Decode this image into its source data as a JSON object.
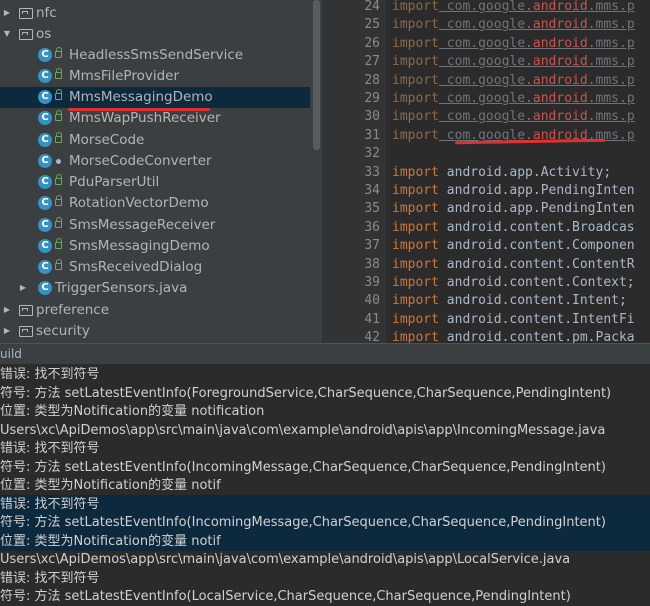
{
  "tree": {
    "items": [
      {
        "label": "nfc",
        "type": "folder",
        "expanded": false
      },
      {
        "label": "os",
        "type": "folder",
        "expanded": true
      },
      {
        "label": "HeadlessSmsSendService",
        "type": "class"
      },
      {
        "label": "MmsFileProvider",
        "type": "class"
      },
      {
        "label": "MmsMessagingDemo",
        "type": "class",
        "selected": true
      },
      {
        "label": "MmsWapPushReceiver",
        "type": "class"
      },
      {
        "label": "MorseCode",
        "type": "class"
      },
      {
        "label": "MorseCodeConverter",
        "type": "class"
      },
      {
        "label": "PduParserUtil",
        "type": "class"
      },
      {
        "label": "RotationVectorDemo",
        "type": "class"
      },
      {
        "label": "SmsMessageReceiver",
        "type": "class"
      },
      {
        "label": "SmsMessagingDemo",
        "type": "class"
      },
      {
        "label": "SmsReceivedDialog",
        "type": "class"
      },
      {
        "label": "TriggerSensors.java",
        "type": "class-file"
      },
      {
        "label": "preference",
        "type": "folder",
        "expanded": false
      },
      {
        "label": "security",
        "type": "folder",
        "expanded": false
      }
    ]
  },
  "editor": {
    "lines": [
      {
        "num": "24",
        "text": "import com.google.android.mms.p"
      },
      {
        "num": "25",
        "text": "import com.google.android.mms.p"
      },
      {
        "num": "26",
        "text": "import com.google.android.mms.p"
      },
      {
        "num": "27",
        "text": "import com.google.android.mms.p"
      },
      {
        "num": "28",
        "text": "import com.google.android.mms.p"
      },
      {
        "num": "29",
        "text": "import com.google.android.mms.p"
      },
      {
        "num": "30",
        "text": "import com.google.android.mms.p"
      },
      {
        "num": "31",
        "text": "import com.google.android.mms.p"
      },
      {
        "num": "32",
        "text": ""
      },
      {
        "num": "33",
        "text": "import android.app.Activity;"
      },
      {
        "num": "34",
        "text": "import android.app.PendingInten"
      },
      {
        "num": "35",
        "text": "import android.app.PendingInten"
      },
      {
        "num": "36",
        "text": "import android.content.Broadcas"
      },
      {
        "num": "37",
        "text": "import android.content.Componen"
      },
      {
        "num": "38",
        "text": "import android.content.ContentR"
      },
      {
        "num": "39",
        "text": "import android.content.Context;"
      },
      {
        "num": "40",
        "text": "import android.content.Intent;"
      },
      {
        "num": "41",
        "text": "import android.content.IntentFi"
      },
      {
        "num": "42",
        "text": "import android.content.pm.Packa"
      }
    ]
  },
  "build": {
    "title": "uild",
    "messages": [
      "错误: 找不到符号",
      "符号:   方法 setLatestEventInfo(ForegroundService,CharSequence,CharSequence,PendingIntent)",
      "位置: 类型为Notification的变量 notification",
      "Users\\xc\\ApiDemos\\app\\src\\main\\java\\com\\example\\android\\apis\\app\\IncomingMessage.java",
      "错误: 找不到符号",
      "符号:   方法 setLatestEventInfo(IncomingMessage,CharSequence,CharSequence,PendingIntent)",
      "位置: 类型为Notification的变量 notif",
      "错误: 找不到符号",
      "符号:   方法 setLatestEventInfo(IncomingMessage,CharSequence,CharSequence,PendingIntent)",
      "位置: 类型为Notification的变量 notif",
      "Users\\xc\\ApiDemos\\app\\src\\main\\java\\com\\example\\android\\apis\\app\\LocalService.java",
      "错误: 找不到符号",
      "符号:   方法 setLatestEventInfo(LocalService,CharSequence,CharSequence,PendingIntent)"
    ],
    "selected_rows": [
      7,
      8,
      9
    ]
  },
  "colors": {
    "keyword": "#cc7832",
    "selection": "#0d293e",
    "error_underline": "#e03030"
  }
}
